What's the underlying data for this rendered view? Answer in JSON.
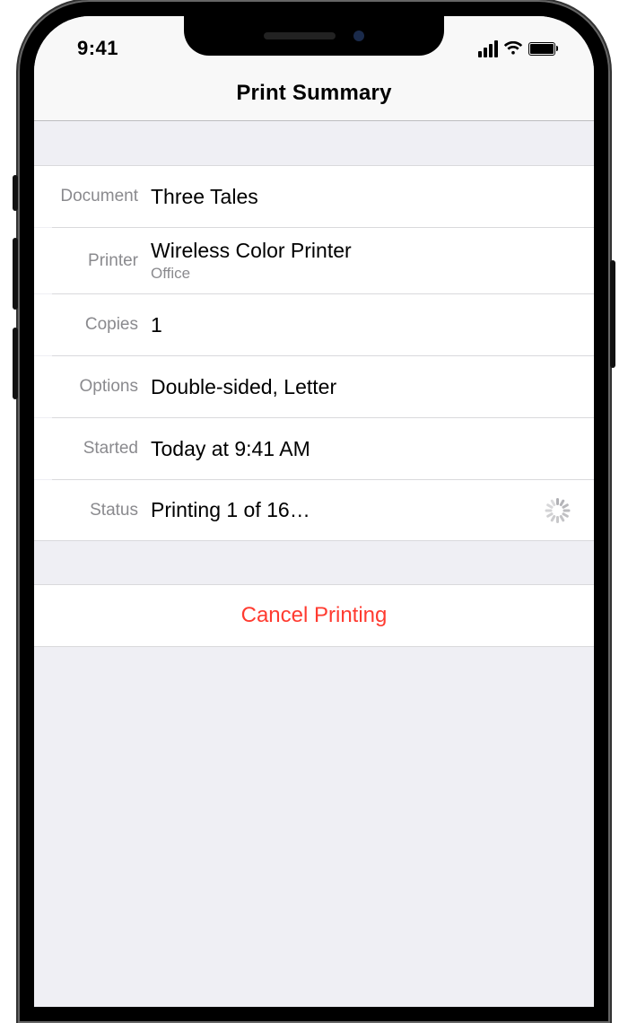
{
  "status_bar": {
    "time": "9:41"
  },
  "nav": {
    "title": "Print Summary"
  },
  "rows": {
    "document": {
      "label": "Document",
      "value": "Three Tales"
    },
    "printer": {
      "label": "Printer",
      "value": "Wireless Color Printer",
      "sub": "Office"
    },
    "copies": {
      "label": "Copies",
      "value": "1"
    },
    "options": {
      "label": "Options",
      "value": "Double-sided, Letter"
    },
    "started": {
      "label": "Started",
      "value": "Today at 9:41 AM"
    },
    "status": {
      "label": "Status",
      "value": "Printing 1 of 16…"
    }
  },
  "cancel": {
    "label": "Cancel Printing"
  },
  "colors": {
    "destructive": "#ff3b30",
    "group_bg": "#efeff4",
    "hairline": "#d9d9dc",
    "secondary_text": "#8a8a8e"
  }
}
